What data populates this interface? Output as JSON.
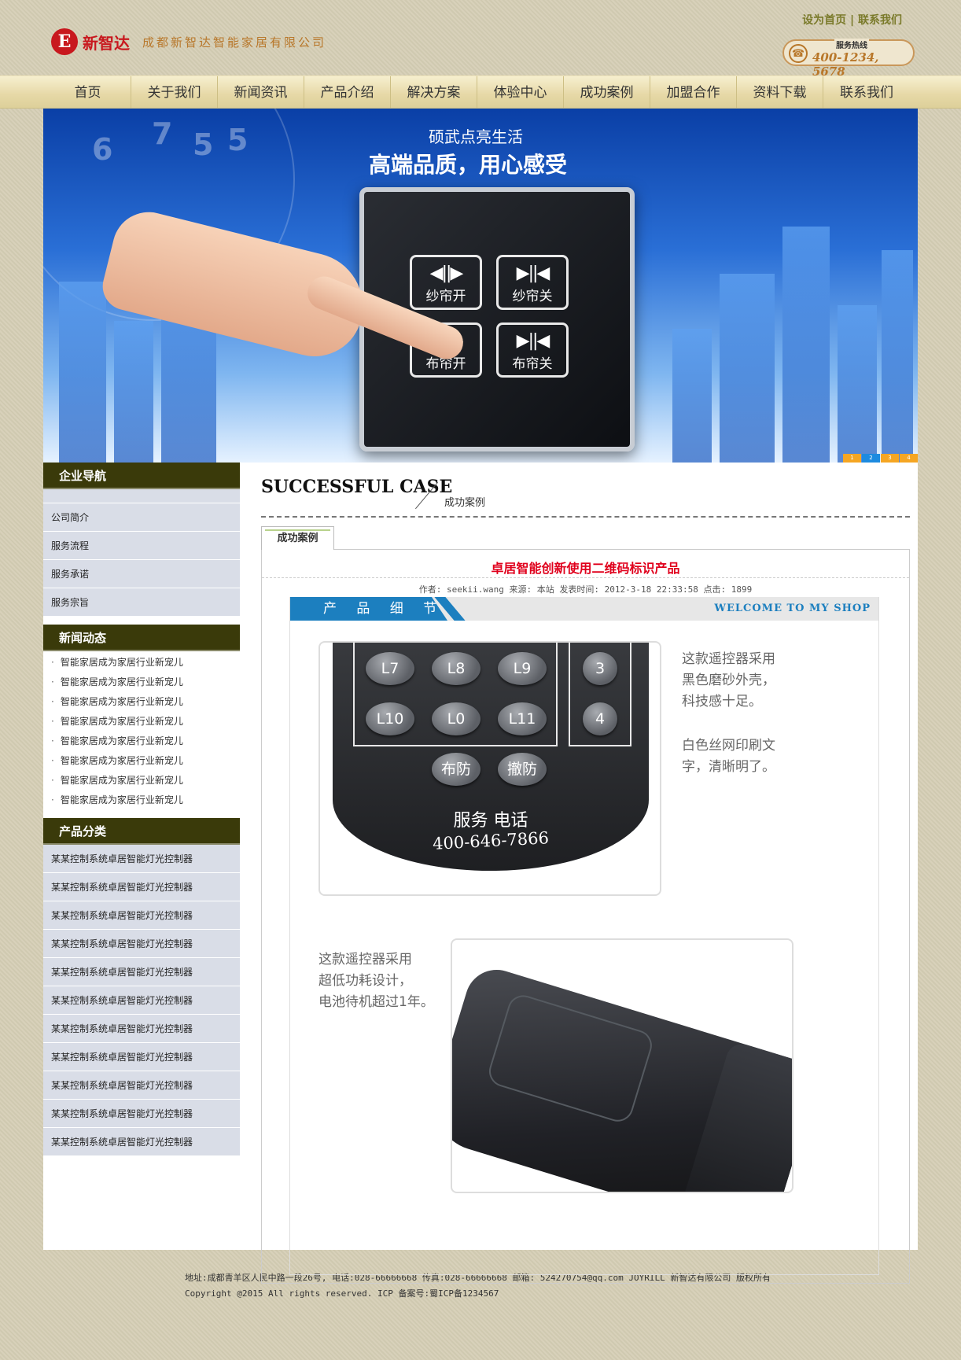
{
  "header": {
    "logo_mark": "E",
    "logo_text": "新智达",
    "company": "成都新智达智能家居有限公司",
    "links": [
      "设为首页",
      "联系我们"
    ],
    "hotline_label": "服务热线",
    "hotline_number": "400-1234, 5678"
  },
  "nav": [
    "首页",
    "关于我们",
    "新闻资讯",
    "产品介绍",
    "解决方案",
    "体验中心",
    "成功案例",
    "加盟合作",
    "资料下载",
    "联系我们"
  ],
  "banner": {
    "subtitle": "硕武点亮生活",
    "title": "高端品质，用心感受",
    "buttons": [
      {
        "icon": "◀||▶",
        "label": "纱帘开"
      },
      {
        "icon": "▶||◀",
        "label": "纱帘关"
      },
      {
        "icon": "◀||▶",
        "label": "布帘开"
      },
      {
        "icon": "▶||◀",
        "label": "布帘关"
      }
    ],
    "clock_numbers": [
      "6",
      "7",
      "5",
      "5"
    ],
    "pager": [
      "1",
      "2",
      "3",
      "4"
    ],
    "pager_active": 2
  },
  "sidebar": {
    "nav_title": "企业导航",
    "nav_items": [
      "公司简介",
      "服务流程",
      "服务承诺",
      "服务宗旨"
    ],
    "news_title": "新闻动态",
    "news_items": [
      "智能家居成为家居行业新宠儿",
      "智能家居成为家居行业新宠儿",
      "智能家居成为家居行业新宠儿",
      "智能家居成为家居行业新宠儿",
      "智能家居成为家居行业新宠儿",
      "智能家居成为家居行业新宠儿",
      "智能家居成为家居行业新宠儿",
      "智能家居成为家居行业新宠儿"
    ],
    "product_title": "产品分类",
    "product_items": [
      "某某控制系统卓居智能灯光控制器",
      "某某控制系统卓居智能灯光控制器",
      "某某控制系统卓居智能灯光控制器",
      "某某控制系统卓居智能灯光控制器",
      "某某控制系统卓居智能灯光控制器",
      "某某控制系统卓居智能灯光控制器",
      "某某控制系统卓居智能灯光控制器",
      "某某控制系统卓居智能灯光控制器",
      "某某控制系统卓居智能灯光控制器",
      "某某控制系统卓居智能灯光控制器",
      "某某控制系统卓居智能灯光控制器"
    ]
  },
  "content": {
    "heading_en": "SUCCESSFUL CASE",
    "heading_cn": "成功案例",
    "tab": "成功案例",
    "article_title": "卓居智能创新使用二维码标识产品",
    "meta": "作者: seekii.wang 来源: 本站 发表时间: 2012-3-18 22:33:58 点击: 1899",
    "detail_label": "产 品 细 节",
    "welcome": "WELCOME TO MY SHOP",
    "remote_buttons_row1": [
      "L7",
      "L8",
      "L9",
      "3"
    ],
    "remote_buttons_row2": [
      "L10",
      "L0",
      "L11",
      "4"
    ],
    "remote_buttons_row3": [
      "布防",
      "撤防"
    ],
    "remote_service": "服务  电话",
    "remote_phone": "400-646-7866",
    "text1_line1": "这款遥控器采用",
    "text1_line2": "黑色磨砂外壳，",
    "text1_line3": "科技感十足。",
    "text2_line1": "白色丝网印刷文",
    "text2_line2": "字，清晰明了。",
    "text3_line1": "这款遥控器采用",
    "text3_line2": "超低功耗设计，",
    "text3_line3": "电池待机超过1年。"
  },
  "footer": {
    "line1": "地址:成都青羊区人民中路一段26号, 电话:028-66666668 传真:028-66666668 邮箱: 524270754@qq.com JOYRILL 新智达有限公司 版权所有",
    "line2": "Copyright @2015 All rights reserved. ICP 备案号:蜀ICP备1234567"
  },
  "colors": {
    "page_bg": "#d6cfb6",
    "nav_bg": "#e6d8a6",
    "sidebar_head": "#3a3a0a",
    "sidebar_item": "#d9dde7",
    "title_red": "#e0001c",
    "detail_blue": "#1c7fbf",
    "hotline_orange": "#b8772a"
  }
}
